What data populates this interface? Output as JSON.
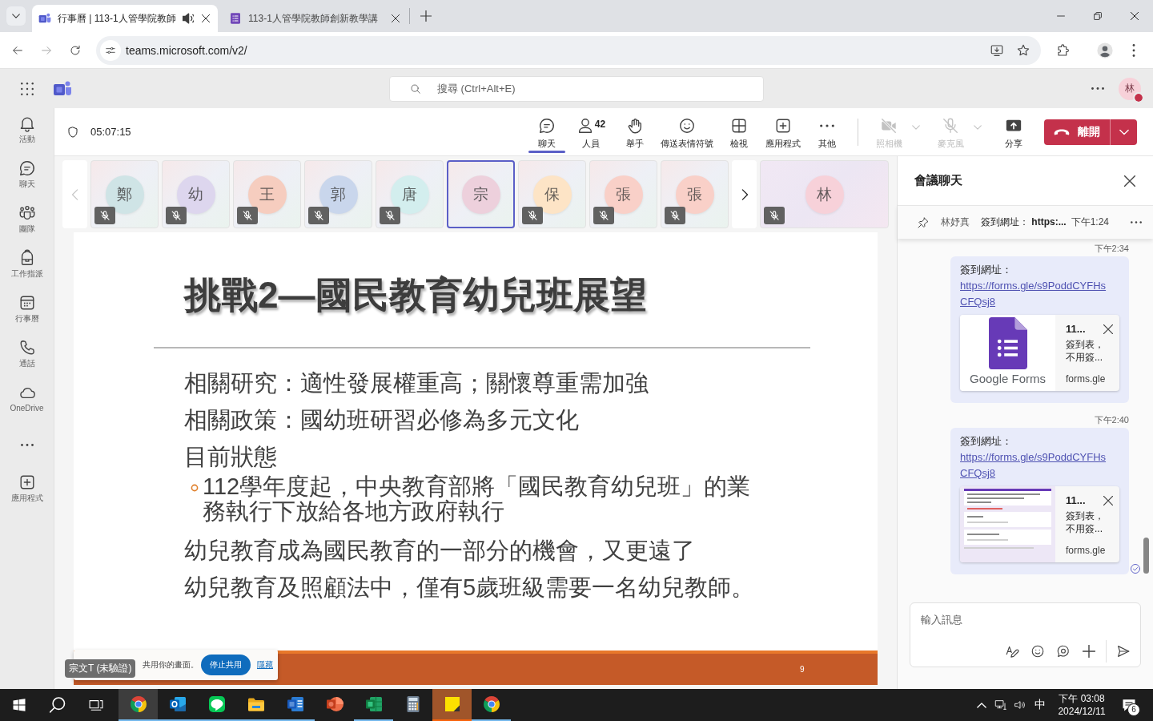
{
  "browser": {
    "tabs": [
      {
        "kind": "teams",
        "title": "行事曆 | 113-1人管學院教師",
        "audio": true,
        "selected": true
      },
      {
        "kind": "forms",
        "title": "113-1人管學院教師創新教學講",
        "audio": false,
        "selected": false
      }
    ],
    "address": "teams.microsoft.com/v2/"
  },
  "teams_header": {
    "search_placeholder": "搜尋 (Ctrl+Alt+E)",
    "avatar": "林",
    "busy": true
  },
  "rail": [
    {
      "kind": "activity",
      "label": "活動"
    },
    {
      "kind": "chat",
      "label": "聊天"
    },
    {
      "kind": "teams",
      "label": "團隊"
    },
    {
      "kind": "assignments",
      "label": "工作指派"
    },
    {
      "kind": "calendar",
      "label": "行事曆"
    },
    {
      "kind": "calls",
      "label": "通話"
    },
    {
      "kind": "onedrive",
      "label": "OneDrive"
    },
    {
      "kind": "more"
    },
    {
      "kind": "apps",
      "label": "應用程式"
    }
  ],
  "meeting": {
    "elapsed": "05:07:15",
    "toolbar": [
      {
        "kind": "chat",
        "label": "聊天",
        "selected": true
      },
      {
        "kind": "people",
        "label": "人員",
        "count": "42",
        "selected": false
      },
      {
        "kind": "raise_hand",
        "label": "舉手",
        "selected": false
      },
      {
        "kind": "react",
        "label": "傳送表情符號",
        "selected": false
      },
      {
        "kind": "view",
        "label": "檢視",
        "selected": false
      },
      {
        "kind": "apps",
        "label": "應用程式",
        "selected": false
      },
      {
        "kind": "more",
        "label": "其他",
        "selected": false
      }
    ],
    "devices": [
      {
        "kind": "camera",
        "label": "照相機",
        "disabled": true
      },
      {
        "kind": "mic",
        "label": "麥克風",
        "disabled": true
      }
    ],
    "share_label": "分享",
    "leave_label": "離開"
  },
  "participant_strip": {
    "prev_disabled": true,
    "next_disabled": false,
    "tiles": [
      {
        "initial": "鄭",
        "color": "#cfe4e6",
        "muted": true,
        "speaking": false
      },
      {
        "initial": "幼",
        "color": "#ddd6ee",
        "muted": true,
        "speaking": false
      },
      {
        "initial": "王",
        "color": "#f6cdbf",
        "muted": true,
        "speaking": false
      },
      {
        "initial": "郭",
        "color": "#c9d6ec",
        "muted": true,
        "speaking": false
      },
      {
        "initial": "唐",
        "color": "#d3eeee",
        "muted": true,
        "speaking": false
      },
      {
        "initial": "宗",
        "color": "#edd0dc",
        "muted": false,
        "speaking": true
      },
      {
        "initial": "保",
        "color": "#fde4c6",
        "muted": true,
        "speaking": false
      },
      {
        "initial": "張",
        "color": "#f9d0c8",
        "muted": true,
        "speaking": false
      },
      {
        "initial": "張",
        "color": "#f9d0c8",
        "muted": true,
        "speaking": false
      }
    ],
    "self": {
      "initial": "林",
      "color": "#f7d1d9",
      "muted": true
    }
  },
  "slide": {
    "title": "挑戰2—國民教育幼兒班展望",
    "lines": [
      {
        "kind": "item",
        "text": "相關研究：適性發展權重高；關懷尊重需加強"
      },
      {
        "kind": "item",
        "text": "相關政策：國幼班研習必修為多元文化"
      },
      {
        "kind": "item",
        "text": "目前狀態"
      },
      {
        "kind": "subitem",
        "text": "112學年度起，中央教育部將「國民教育幼兒班」的業務執行下放給各地方政府執行"
      },
      {
        "kind": "item",
        "text": "幼兒教育成為國民教育的一部分的機會，又更遠了"
      },
      {
        "kind": "item",
        "text": "幼兒教育及照顧法中，僅有5歲班級需要一名幼兒教師。"
      }
    ],
    "page": "9"
  },
  "sharing_bar": {
    "presenter": "宗文T (未驗證)",
    "message": "共用你的畫面。",
    "stop_label": "停止共用",
    "hide_label": "隱藏"
  },
  "chat": {
    "title": "會議聊天",
    "pinned": {
      "author": "林妤真",
      "text": "簽到網址： **https:...**",
      "time": "下午1:24"
    },
    "messages": [
      {
        "time": "下午2:34",
        "text": "簽到網址：",
        "link": "https://forms.gle/s9PoddCYFHsCFQsj8",
        "preview": {
          "kind": "logo",
          "image_caption": "Google Forms",
          "title": "11...",
          "description": "簽到表，不用簽...",
          "domain": "forms.gle"
        },
        "read": false
      },
      {
        "time": "下午2:40",
        "text": "簽到網址：",
        "link": "https://forms.gle/s9PoddCYFHsCFQsj8",
        "preview": {
          "kind": "page",
          "title": "11...",
          "description": "簽到表，不用簽...",
          "domain": "forms.gle"
        },
        "read": true
      }
    ],
    "placeholder": "輸入訊息"
  },
  "taskbar": {
    "apps": [
      {
        "kind": "chrome",
        "running": true,
        "active": true,
        "flashing": false
      },
      {
        "kind": "outlook",
        "running": true,
        "active": false,
        "flashing": false
      },
      {
        "kind": "line",
        "running": true,
        "active": false,
        "flashing": false
      },
      {
        "kind": "explorer",
        "running": true,
        "active": false,
        "flashing": false
      },
      {
        "kind": "word",
        "running": true,
        "active": false,
        "flashing": false
      },
      {
        "kind": "powerpoint",
        "running": false,
        "active": false,
        "flashing": false
      },
      {
        "kind": "excel",
        "running": true,
        "active": false,
        "flashing": false
      },
      {
        "kind": "calculator",
        "running": false,
        "active": false,
        "flashing": false
      },
      {
        "kind": "sticky_notes",
        "running": true,
        "active": false,
        "flashing": true
      },
      {
        "kind": "chrome",
        "running": true,
        "active": false,
        "flashing": false
      }
    ],
    "ime": "中",
    "time": "下午 03:08",
    "date": "2024/12/11",
    "notifications": "6"
  }
}
